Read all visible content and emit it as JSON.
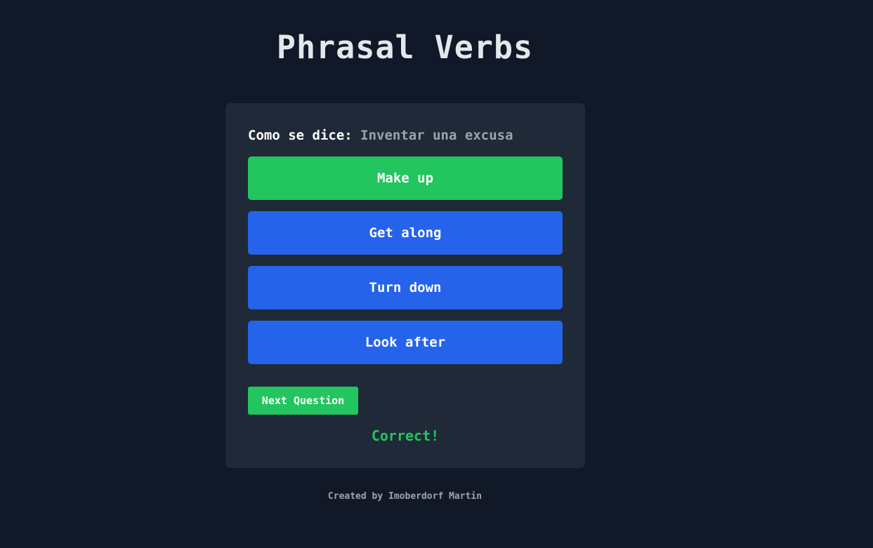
{
  "header": {
    "title": "Phrasal Verbs"
  },
  "quiz": {
    "question_label": "Como se dice:",
    "question_text": "Inventar una excusa",
    "options": [
      {
        "label": "Make up",
        "state": "correct"
      },
      {
        "label": "Get along",
        "state": "default"
      },
      {
        "label": "Turn down",
        "state": "default"
      },
      {
        "label": "Look after",
        "state": "default"
      }
    ],
    "next_label": "Next Question",
    "feedback": "Correct!"
  },
  "footer": {
    "credit": "Created by Imoberdorf Martin"
  },
  "colors": {
    "background": "#111827",
    "card": "#1f2937",
    "correct": "#22c55e",
    "option_default": "#2563eb",
    "muted_text": "#9ca3af"
  }
}
